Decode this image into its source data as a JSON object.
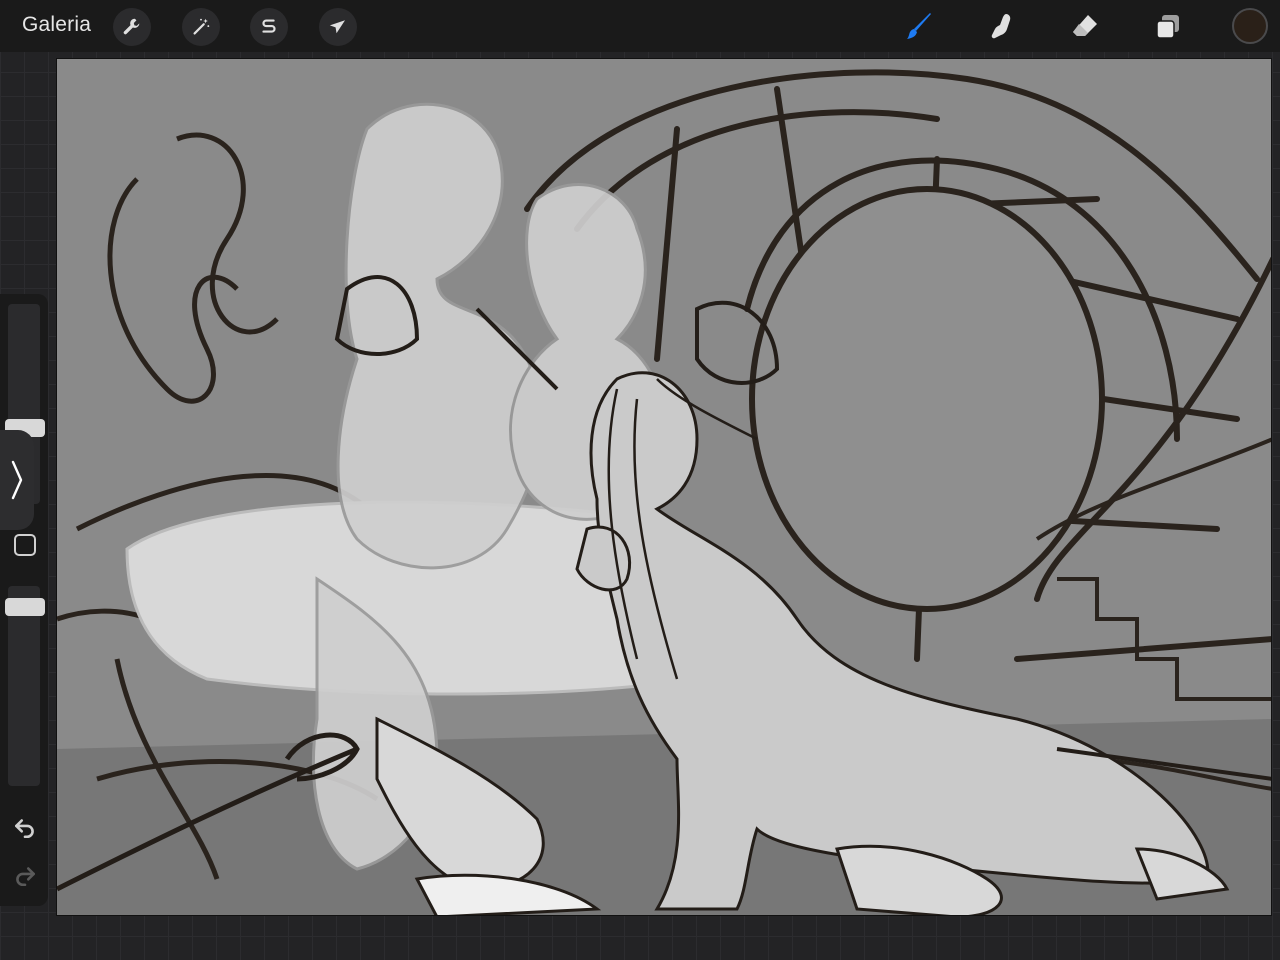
{
  "topbar": {
    "gallery_label": "Galeria",
    "left_tools": [
      {
        "name": "actions",
        "icon": "wrench-icon"
      },
      {
        "name": "adjustments",
        "icon": "magic-wand-icon"
      },
      {
        "name": "selection",
        "icon": "selection-s-icon"
      },
      {
        "name": "transform",
        "icon": "arrow-cursor-icon"
      }
    ],
    "right_tools": [
      {
        "name": "brush",
        "icon": "brush-icon",
        "active": true,
        "color": "#1e7bf2"
      },
      {
        "name": "smudge",
        "icon": "smudge-finger-icon",
        "active": false
      },
      {
        "name": "eraser",
        "icon": "eraser-icon",
        "active": false
      },
      {
        "name": "layers",
        "icon": "layers-icon",
        "active": false
      }
    ],
    "current_color": "#2a2018"
  },
  "sidebar": {
    "brush_size_level": 0.62,
    "opacity_level": 0.0,
    "modify_icon": "square-icon",
    "undo_icon": "undo-icon",
    "redo_icon": "redo-icon",
    "collapse_icon": "chevron-right-icon"
  },
  "canvas": {
    "background": "#8a8a8a",
    "content": "sketch-drawing"
  }
}
